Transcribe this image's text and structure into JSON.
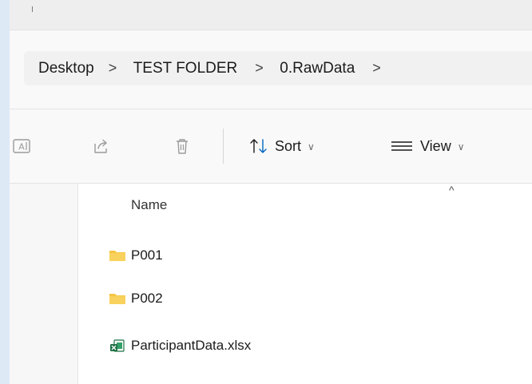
{
  "breadcrumb": {
    "items": [
      "Desktop",
      "TEST FOLDER",
      "0.RawData"
    ],
    "separator": ">"
  },
  "toolbar": {
    "rename_icon": "rename-icon",
    "share_icon": "share-icon",
    "delete_icon": "delete-icon",
    "sort_label": "Sort",
    "view_label": "View",
    "chevron": "∨"
  },
  "file_list": {
    "column_name": "Name",
    "sort_indicator": "^",
    "items": [
      {
        "name": "P001",
        "type": "folder"
      },
      {
        "name": "P002",
        "type": "folder"
      },
      {
        "name": "ParticipantData.xlsx",
        "type": "excel"
      }
    ]
  },
  "colors": {
    "folder": "#f5c542",
    "excel_green": "#1e7145",
    "accent": "#0067c0"
  }
}
